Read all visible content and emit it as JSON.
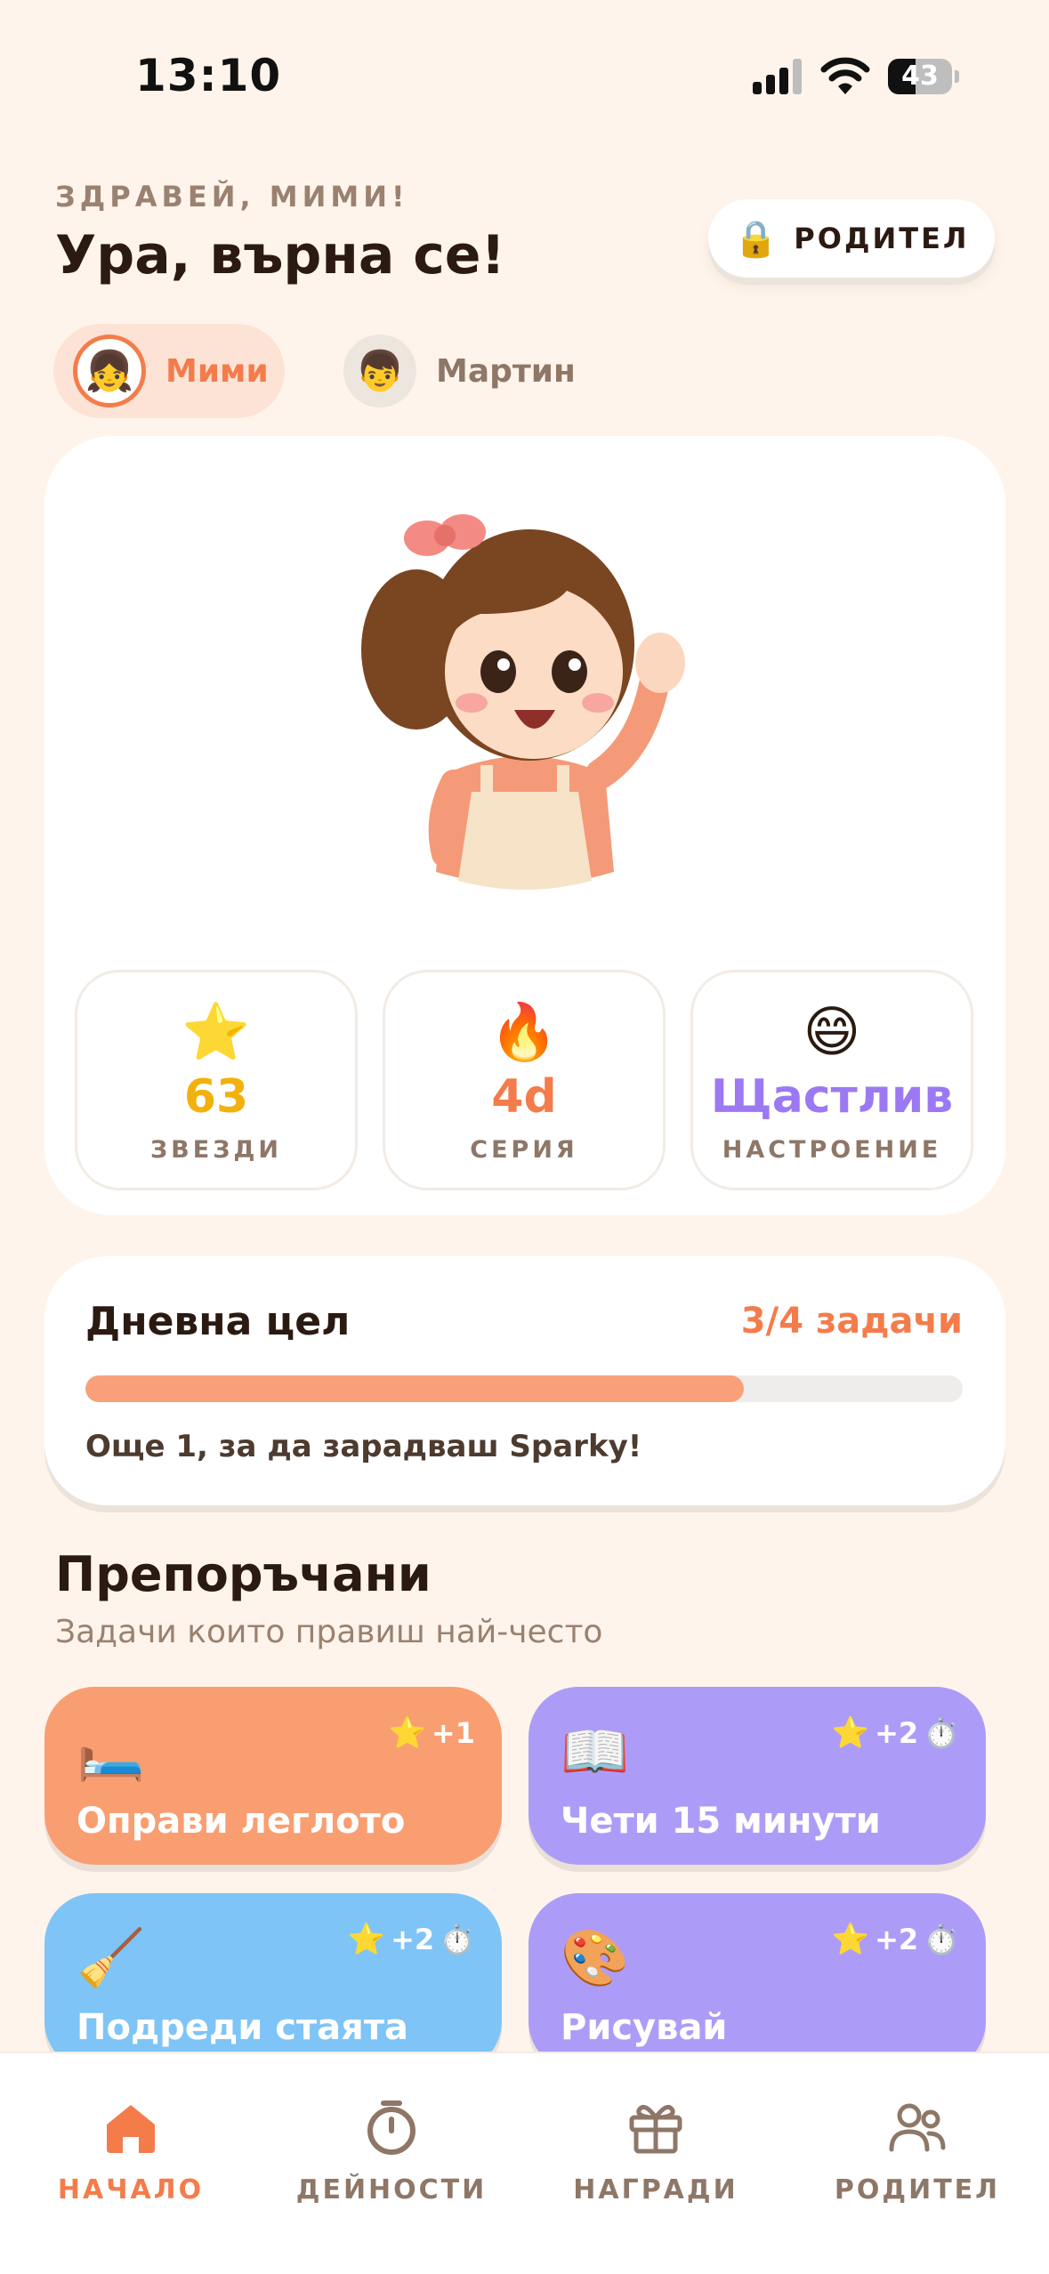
{
  "status_bar": {
    "time": "13:10",
    "battery": "43",
    "battery_level": 0.43
  },
  "header": {
    "greeting": "ЗДРАВЕЙ, МИМИ!",
    "title": "Ура, върна се!",
    "parent_button": {
      "icon": "lock-icon",
      "label": "РОДИТЕЛ"
    }
  },
  "profiles": [
    {
      "name": "Мими",
      "icon": "girl-avatar-icon",
      "active": true
    },
    {
      "name": "Мартин",
      "icon": "boy-avatar-icon",
      "active": false
    }
  ],
  "stats": [
    {
      "emoji": "⭐",
      "value": "63",
      "label": "ЗВЕЗДИ",
      "color": "#F2B10C"
    },
    {
      "emoji": "🔥",
      "value": "4d",
      "label": "СЕРИЯ",
      "color": "#F47C4B"
    },
    {
      "emoji": "😄",
      "value": "Щастлив",
      "label": "НАСТРОЕНИЕ",
      "color": "#9C79F2"
    }
  ],
  "daily_goal": {
    "title": "Дневна цел",
    "count_text": "3/4 задачи",
    "progress": 0.75,
    "message": "Още 1, за да зарадваш Sparky!"
  },
  "recommended": {
    "title": "Препоръчани",
    "subtitle": "Задачи които правиш най-често",
    "tasks": [
      {
        "name": "Оправи леглото",
        "emoji": "🛏️",
        "reward": "+1",
        "timer": false,
        "color": "#F99E71"
      },
      {
        "name": "Чети 15 минути",
        "emoji": "📖",
        "reward": "+2",
        "timer": true,
        "color": "#AD9CF7"
      },
      {
        "name": "Подреди стаята",
        "emoji": "🧹",
        "reward": "+2",
        "timer": true,
        "color": "#7EC4F7"
      },
      {
        "name": "Рисувай",
        "emoji": "🎨",
        "reward": "+2",
        "timer": true,
        "color": "#AD9CF7"
      }
    ]
  },
  "bottom_nav": [
    {
      "label": "НАЧАЛО",
      "icon": "home-icon",
      "active": true
    },
    {
      "label": "ДЕЙНОСТИ",
      "icon": "timer-icon",
      "active": false
    },
    {
      "label": "НАГРАДИ",
      "icon": "gift-icon",
      "active": false
    },
    {
      "label": "РОДИТЕЛ",
      "icon": "people-icon",
      "active": false
    }
  ],
  "colors": {
    "accent": "#F47C4B",
    "background": "#FFF4EB",
    "muted": "#8E7767"
  }
}
